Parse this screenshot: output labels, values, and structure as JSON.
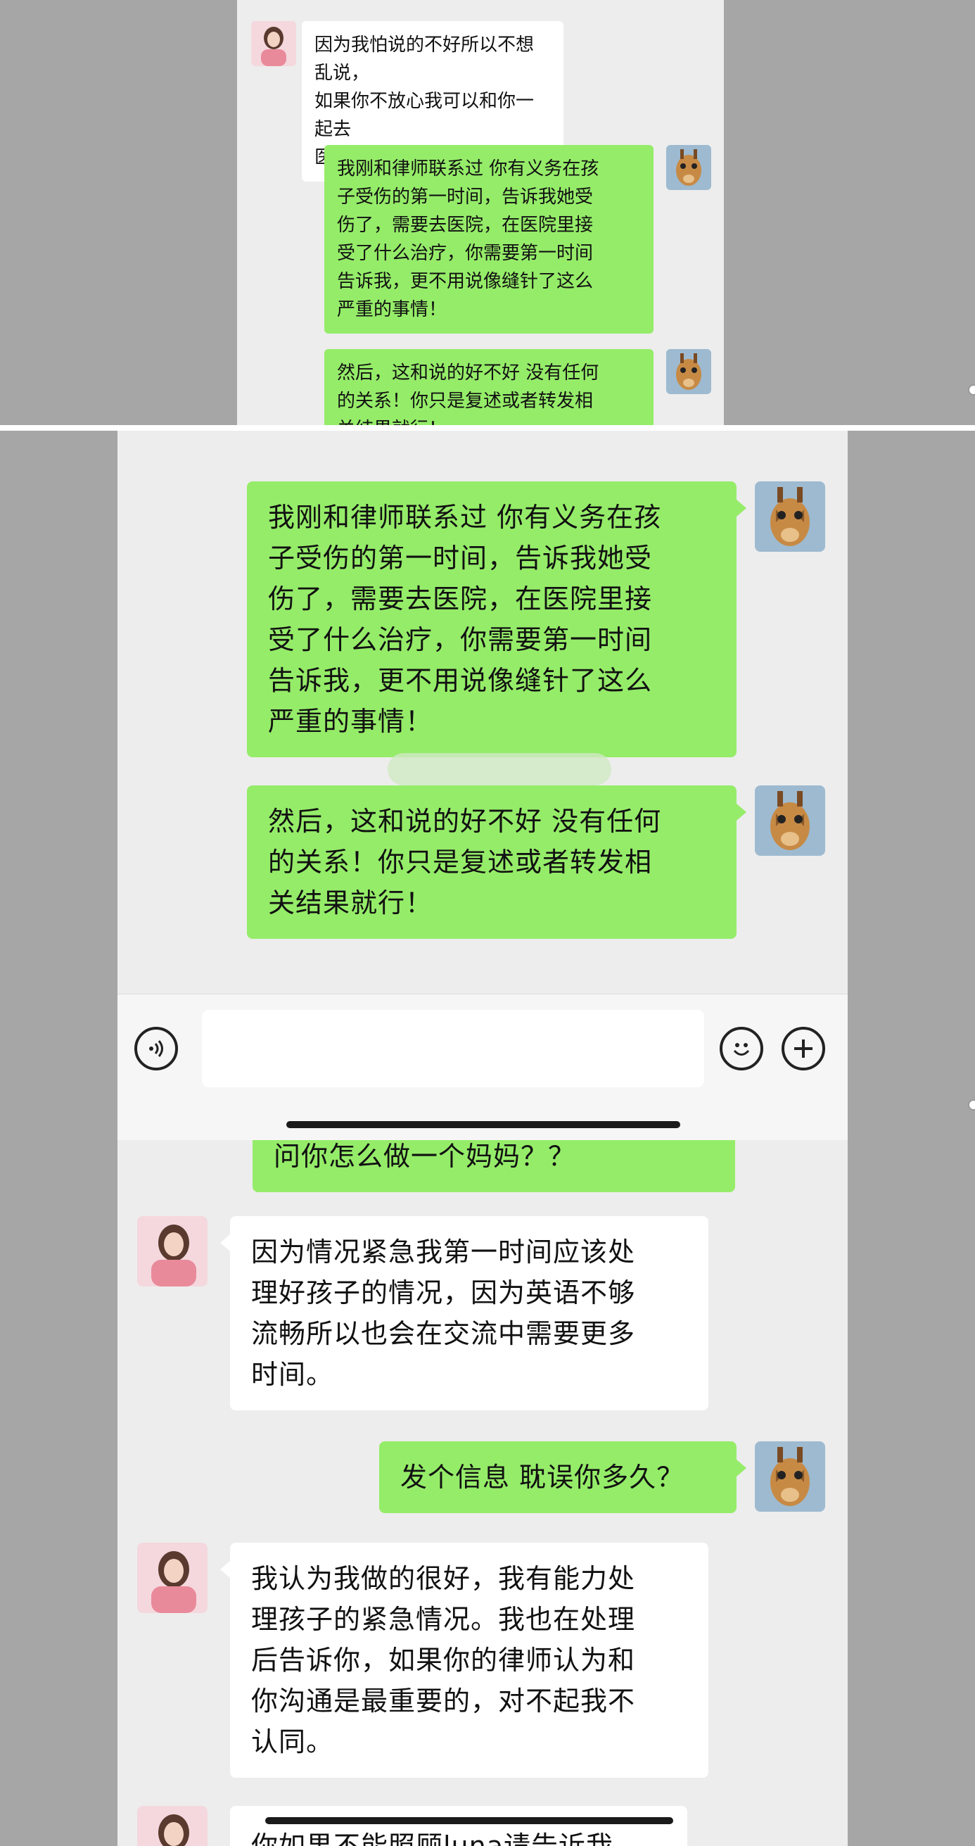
{
  "panel1": {
    "messages": [
      {
        "side": "left",
        "text": "因为我怕说的不好所以不想乱说，\n如果你不放心我可以和你一起去\n医院"
      },
      {
        "side": "right",
        "text": "我刚和律师联系过 你有义务在孩\n子受伤的第一时间，告诉我她受\n伤了，需要去医院，在医院里接\n受了什么治疗，你需要第一时间\n告诉我，更不用说像缝针了这么\n严重的事情！"
      },
      {
        "side": "right",
        "text": "然后，这和说的好不好 没有任何\n的关系！你只是复述或者转发相\n关结果就行！"
      }
    ]
  },
  "panel2": {
    "messages": [
      {
        "side": "right",
        "text": "我刚和律师联系过 你有义务在孩\n子受伤的第一时间，告诉我她受\n伤了，需要去医院，在医院里接\n受了什么治疗，你需要第一时间\n告诉我，更不用说像缝针了这么\n严重的事情！"
      },
      {
        "side": "right",
        "text": "然后，这和说的好不好 没有任何\n的关系！你只是复述或者转发相\n关结果就行！"
      }
    ],
    "toolbar": {
      "voice_icon": "voice-icon",
      "emoji_icon": "emoji-icon",
      "plus_icon": "plus-icon",
      "input_value": ""
    }
  },
  "panel3": {
    "cut_top_text": "问你怎么做一个妈妈？？",
    "messages": [
      {
        "side": "left",
        "text": "因为情况紧急我第一时间应该处\n理好孩子的情况，因为英语不够\n流畅所以也会在交流中需要更多\n时间。"
      },
      {
        "side": "right",
        "text": "发个信息 耽误你多久？"
      },
      {
        "side": "left",
        "text": "我认为我做的很好，我有能力处\n理孩子的紧急情况。我也在处理\n后告诉你，如果你的律师认为和\n你沟通是最重要的，对不起我不\n认同。"
      }
    ],
    "cut_bottom_text": "你如果不能照顾luna请告诉我"
  },
  "colors": {
    "outgoing_bubble": "#95ec69",
    "incoming_bubble": "#ffffff",
    "chat_background": "#ededed",
    "page_background": "#a6a6a6"
  }
}
